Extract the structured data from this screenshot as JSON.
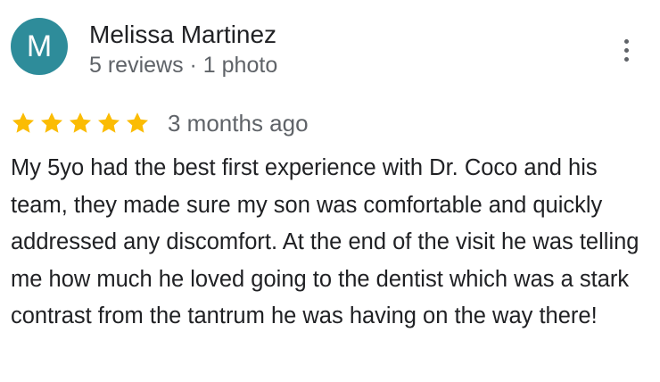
{
  "reviewer": {
    "initial": "M",
    "avatar_color": "#2e8c9a",
    "name": "Melissa Martinez",
    "meta": "5 reviews · 1 photo"
  },
  "menu": {
    "icon": "more-vertical-icon"
  },
  "rating": {
    "stars": 5,
    "max": 5,
    "star_color": "#fbbc04",
    "date": "3 months ago"
  },
  "review": {
    "text": "My 5yo had the best first experience with Dr. Coco and his team, they made sure my son was comfortable and quickly addressed any discomfort. At the end of the visit he was telling me how much he loved going to the dentist which was a stark contrast from the tantrum he was having on the way there!"
  }
}
